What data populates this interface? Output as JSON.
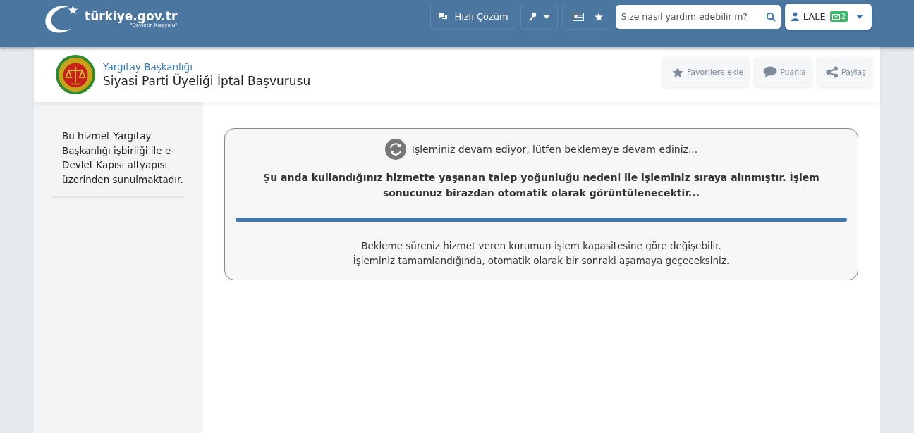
{
  "header": {
    "logo": "türkiye.gov.tr",
    "logo_tagline": "\"Devletin Kısayolu\"",
    "quick_solution": "Hızlı Çözüm",
    "search": {
      "placeholder": "Size nasıl yardım edebilirim?"
    },
    "user": {
      "name": "LALE",
      "message_count": "2"
    }
  },
  "service": {
    "agency": "Yargıtay Başkanlığı",
    "title": "Siyasi Parti Üyeliği İptal Başvurusu",
    "actions": [
      {
        "kind": "favorite",
        "label": "Favorilere ekle"
      },
      {
        "kind": "rate",
        "label": "Puanla"
      },
      {
        "kind": "share",
        "label": "Paylaş"
      }
    ]
  },
  "sidebar": {
    "note": "Bu hizmet Yargıtay Başkanlığı işbirliği ile e-Devlet Kapısı altyapısı üzerinden sunulmaktadır."
  },
  "waiting": {
    "status": "İşleminiz devam ediyor, lütfen beklemeye devam ediniz...",
    "message": "Şu anda kullandığınız hizmette yaşanan talep yoğunluğu nedeni ile işleminiz sıraya alınmıştır. İşlem sonucunuz birazdan otomatik olarak görüntülenecektir...",
    "progress": {
      "level": 1
    },
    "info_lines": [
      "Bekleme süreniz hizmet veren kurumun işlem kapasitesine göre değişebilir.",
      "İşleminiz tamamlandığında, otomatik olarak bir sonraki aşamaya geçeceksiniz."
    ]
  }
}
